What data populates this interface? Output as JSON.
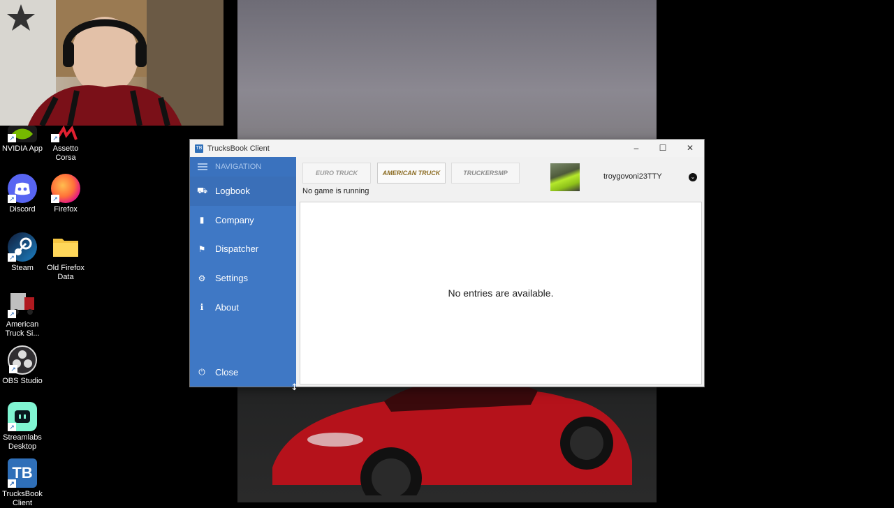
{
  "desktop": {
    "icons": [
      {
        "label": "NVIDIA App",
        "icon": "nvidia-icon"
      },
      {
        "label": "Assetto Corsa",
        "icon": "assetto-corsa-icon"
      },
      {
        "label": "Discord",
        "icon": "discord-icon"
      },
      {
        "label": "Firefox",
        "icon": "firefox-icon"
      },
      {
        "label": "Steam",
        "icon": "steam-icon"
      },
      {
        "label": "Old Firefox Data",
        "icon": "folder-icon"
      },
      {
        "label": "American Truck Si...",
        "icon": "ats-truck-icon"
      },
      {
        "label": "OBS Studio",
        "icon": "obs-icon"
      },
      {
        "label": "Streamlabs Desktop",
        "icon": "streamlabs-icon"
      },
      {
        "label": "TrucksBook Client",
        "icon": "trucksbook-icon"
      }
    ]
  },
  "window": {
    "title": "TrucksBook Client",
    "app_icon_text": "TB",
    "controls": {
      "minimize": "–",
      "maximize": "☐",
      "close": "✕"
    }
  },
  "sidebar": {
    "header": "NAVIGATION",
    "items": [
      {
        "label": "Logbook",
        "icon": "truck-icon",
        "glyph": "⛟"
      },
      {
        "label": "Company",
        "icon": "building-icon",
        "glyph": "▮"
      },
      {
        "label": "Dispatcher",
        "icon": "signpost-icon",
        "glyph": "⚑"
      },
      {
        "label": "Settings",
        "icon": "gears-icon",
        "glyph": "⚙"
      },
      {
        "label": "About",
        "icon": "info-icon",
        "glyph": "ℹ"
      }
    ],
    "close": {
      "label": "Close",
      "icon": "power-icon",
      "glyph": "⏻"
    }
  },
  "games": [
    {
      "label": "EURO TRUCK",
      "icon": "ets2-logo"
    },
    {
      "label": "AMERICAN TRUCK",
      "icon": "ats-logo"
    },
    {
      "label": "TRUCKERSMP",
      "icon": "truckersmp-logo"
    }
  ],
  "status": "No game is running",
  "profile": {
    "username": "troygovoni23TTY",
    "dropdown_glyph": "⌄"
  },
  "logbook": {
    "empty_message": "No entries are available."
  },
  "colors": {
    "sidebar": "#3f78c5",
    "accent": "#2f6fb8"
  }
}
